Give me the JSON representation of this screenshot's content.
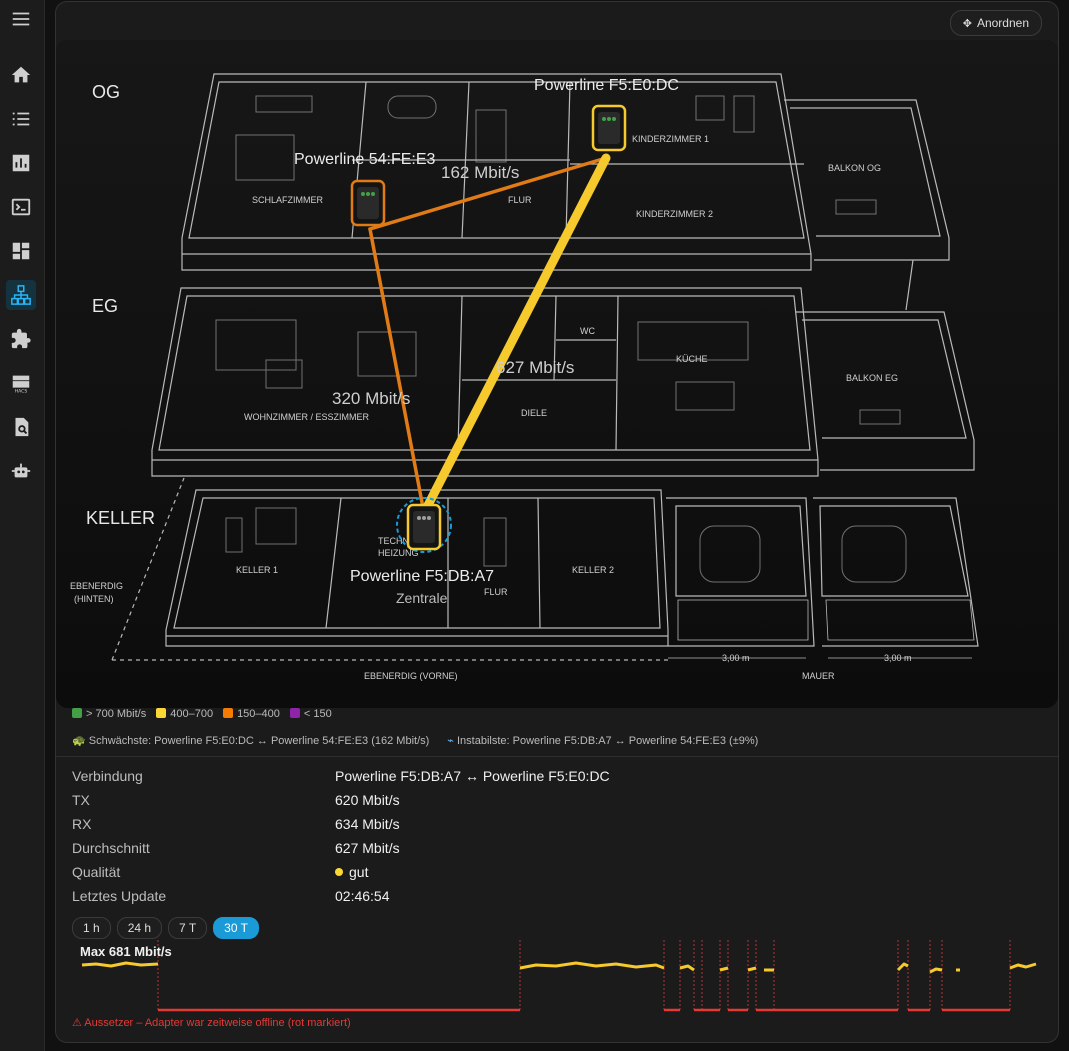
{
  "toolbar": {
    "arrange_label": "Anordnen"
  },
  "floors": [
    {
      "name": "OG"
    },
    {
      "name": "EG"
    },
    {
      "name": "KELLER"
    }
  ],
  "rooms": {
    "schlafzimmer": "SCHLAFZIMMER",
    "flur_og": "FLUR",
    "kinderzimmer1": "KINDERZIMMER 1",
    "kinderzimmer2": "KINDERZIMMER 2",
    "balkon_og": "BALKON OG",
    "wohnzimmer": "WOHNZIMMER / ESSZIMMER",
    "diele": "DIELE",
    "wc": "WC",
    "kueche": "KÜCHE",
    "balkon_eg": "BALKON EG",
    "keller1": "KELLER 1",
    "technik_a": "TECHN",
    "technik_b": "HEIZUNG",
    "flur_keller": "FLUR",
    "keller2": "KELLER 2",
    "ebenerdig_hinten_a": "EBENERDIG",
    "ebenerdig_hinten_b": "(HINTEN)",
    "ebenerdig_vorne": "EBENERDIG (VORNE)",
    "mauer": "MAUER",
    "dim1": "3,00 m",
    "dim2": "3,00 m"
  },
  "devices": {
    "f5e0dc": "Powerline F5:E0:DC",
    "54fee3": "Powerline 54:FE:E3",
    "f5dba7": "Powerline F5:DB:A7",
    "central": "Zentrale"
  },
  "links": {
    "l1": "162 Mbit/s",
    "l2": "320 Mbit/s",
    "l3": "627 Mbit/s"
  },
  "colors": {
    "green": "#43a047",
    "yellow": "#fdd835",
    "orange": "#f57c00",
    "purple": "#8e24aa",
    "link_orange": "#e07b16",
    "link_yellow": "#f6c92c",
    "offline": "#e53935",
    "accent": "#1a9ad6"
  },
  "legend": [
    {
      "label": "> 700 Mbit/s",
      "color": "#43a047"
    },
    {
      "label": "400–700",
      "color": "#fdd835"
    },
    {
      "label": "150–400",
      "color": "#f57c00"
    },
    {
      "label": "< 150",
      "color": "#8e24aa"
    }
  ],
  "summary": {
    "weakest": "Schwächste: Powerline F5:E0:DC ↔ Powerline 54:FE:E3 (162 Mbit/s)",
    "unstable": "Instabilste: Powerline F5:DB:A7 ↔ Powerline 54:FE:E3 (±9%)"
  },
  "details": [
    {
      "key": "Verbindung",
      "value": "Powerline F5:DB:A7 ↔ Powerline F5:E0:DC"
    },
    {
      "key": "TX",
      "value": "620 Mbit/s"
    },
    {
      "key": "RX",
      "value": "634 Mbit/s"
    },
    {
      "key": "Durchschnitt",
      "value": "627 Mbit/s"
    },
    {
      "key": "Qualität",
      "value": "gut"
    },
    {
      "key": "Letztes Update",
      "value": "02:46:54"
    }
  ],
  "ranges": [
    {
      "label": "1 h",
      "active": false
    },
    {
      "label": "24 h",
      "active": false
    },
    {
      "label": "7 T",
      "active": false
    },
    {
      "label": "30 T",
      "active": true
    }
  ],
  "history": {
    "max_label": "Max 681 Mbit/s",
    "warning": "⚠ Aussetzer – Adapter war zeitweise offline (rot markiert)"
  }
}
